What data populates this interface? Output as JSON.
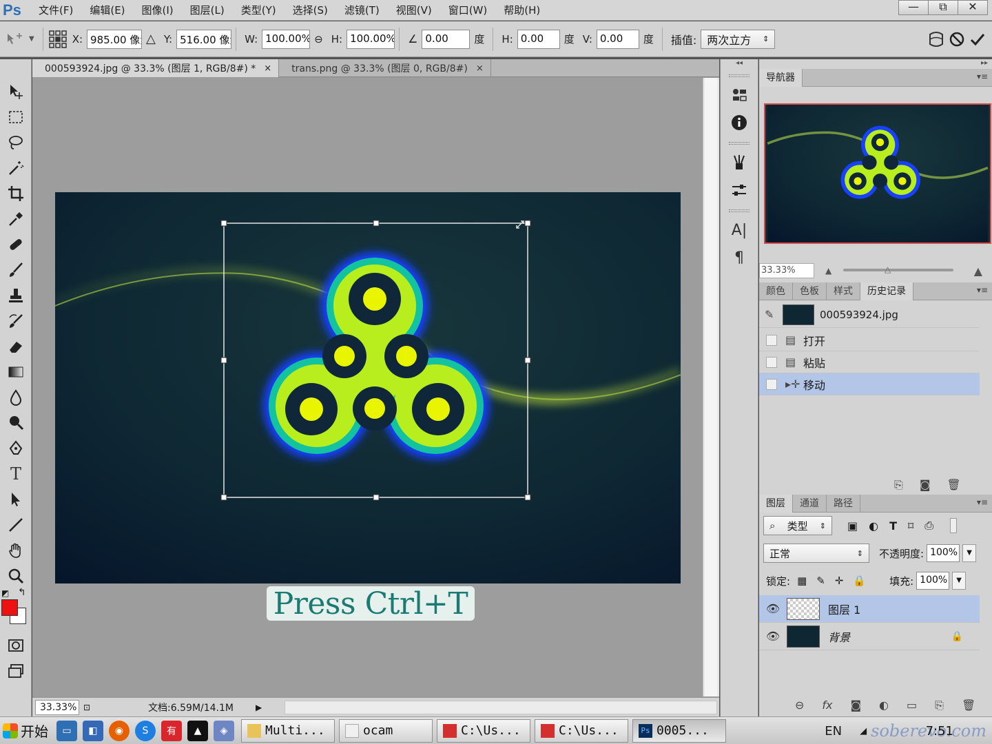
{
  "app": {
    "logo": "Ps"
  },
  "menu": [
    "文件(F)",
    "编辑(E)",
    "图像(I)",
    "图层(L)",
    "类型(Y)",
    "选择(S)",
    "滤镜(T)",
    "视图(V)",
    "窗口(W)",
    "帮助(H)"
  ],
  "window_controls": {
    "minimize": "—",
    "restore": "⧉",
    "close": "✕"
  },
  "options": {
    "x_label": "X:",
    "x_value": "985.00 像素",
    "y_label": "Y:",
    "y_value": "516.00 像素",
    "w_label": "W:",
    "w_value": "100.00%",
    "h_label": "H:",
    "h_value": "100.00%",
    "angle_value": "0.00",
    "degree_unit": "度",
    "skew_h_label": "H:",
    "skew_h_value": "0.00",
    "skew_v_label": "V:",
    "skew_v_value": "0.00",
    "interp_label": "插值:",
    "interp_value": "两次立方"
  },
  "tabs": [
    {
      "label": "000593924.jpg @ 33.3% (图层 1, RGB/8#) *",
      "close": "×"
    },
    {
      "label": "trans.png @ 33.3% (图层 0, RGB/8#)",
      "close": "×"
    }
  ],
  "status": {
    "zoom": "33.33%",
    "doc": "文档:6.59M/14.1M"
  },
  "caption": "Press Ctrl+T",
  "navigator": {
    "tab": "导航器",
    "zoom": "33.33%"
  },
  "history_tabs": [
    "颜色",
    "色板",
    "样式",
    "历史记录"
  ],
  "history": {
    "snapshot": "000593924.jpg",
    "items": [
      "打开",
      "粘贴",
      "移动"
    ]
  },
  "layers_tabs": [
    "图层",
    "通道",
    "路径"
  ],
  "layers": {
    "filter": "类型",
    "blend_mode": "正常",
    "opacity_label": "不透明度:",
    "opacity": "100%",
    "lock_label": "锁定:",
    "fill_label": "填充:",
    "fill": "100%",
    "items": [
      {
        "name": "图层 1"
      },
      {
        "name": "背景"
      }
    ]
  },
  "taskbar": {
    "start": "开始",
    "tasks": [
      "Multi...",
      "ocam",
      "C:\\Us...",
      "C:\\Us...",
      "0005..."
    ],
    "lang": "EN",
    "watermark": "soberevo.com",
    "time": "7:51"
  },
  "colors": {
    "foreground": "#ee1111",
    "background": "#ffffff",
    "selection": "#b4c6e8"
  }
}
